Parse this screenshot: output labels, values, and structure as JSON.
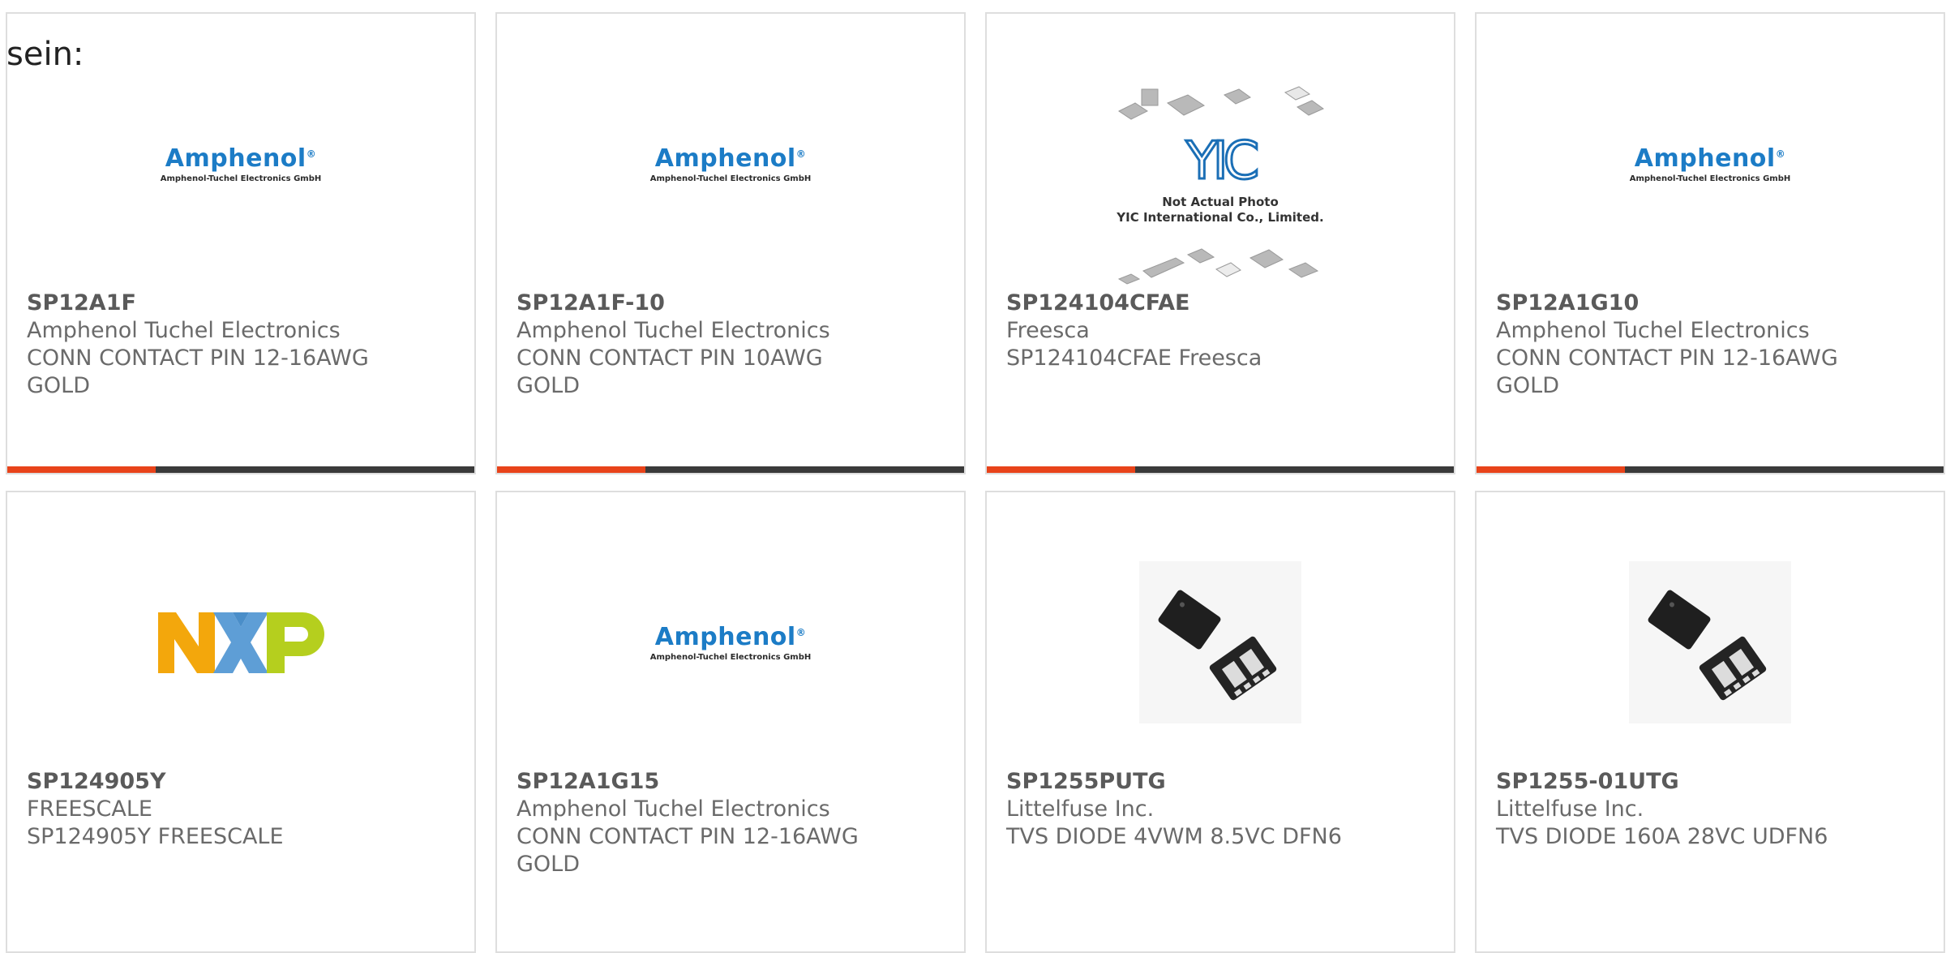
{
  "intro_text": "sein:",
  "accent_color": "#e8431a",
  "bar_color": "#3a3a3a",
  "logos": {
    "amphenol_word": "Amphenol",
    "amphenol_reg": "®",
    "amphenol_sub": "Amphenol-Tuchel Electronics GmbH",
    "yic_line1": "Not Actual Photo",
    "yic_line2": "YIC International Co., Limited."
  },
  "products": [
    {
      "part": "SP12A1F",
      "maker": "Amphenol Tuchel Electronics",
      "desc": "CONN CONTACT PIN 12-16AWG GOLD",
      "image": "amphenol-logo"
    },
    {
      "part": "SP12A1F-10",
      "maker": "Amphenol Tuchel Electronics",
      "desc": "CONN CONTACT PIN 10AWG GOLD",
      "image": "amphenol-logo"
    },
    {
      "part": "SP124104CFAE",
      "maker": "Freesca",
      "desc": "SP124104CFAE Freesca",
      "image": "yic-placeholder"
    },
    {
      "part": "SP12A1G10",
      "maker": "Amphenol Tuchel Electronics",
      "desc": "CONN CONTACT PIN 12-16AWG GOLD",
      "image": "amphenol-logo"
    },
    {
      "part": "SP124905Y",
      "maker": "FREESCALE",
      "desc": "SP124905Y FREESCALE",
      "image": "nxp-logo"
    },
    {
      "part": "SP12A1G15",
      "maker": "Amphenol Tuchel Electronics",
      "desc": "CONN CONTACT PIN 12-16AWG GOLD",
      "image": "amphenol-logo"
    },
    {
      "part": "SP1255PUTG",
      "maker": "Littelfuse Inc.",
      "desc": "TVS DIODE 4VWM 8.5VC DFN6",
      "image": "dfn-chip-photo"
    },
    {
      "part": "SP1255-01UTG",
      "maker": "Littelfuse Inc.",
      "desc": "TVS DIODE 160A 28VC UDFN6",
      "image": "dfn-chip-photo"
    }
  ]
}
